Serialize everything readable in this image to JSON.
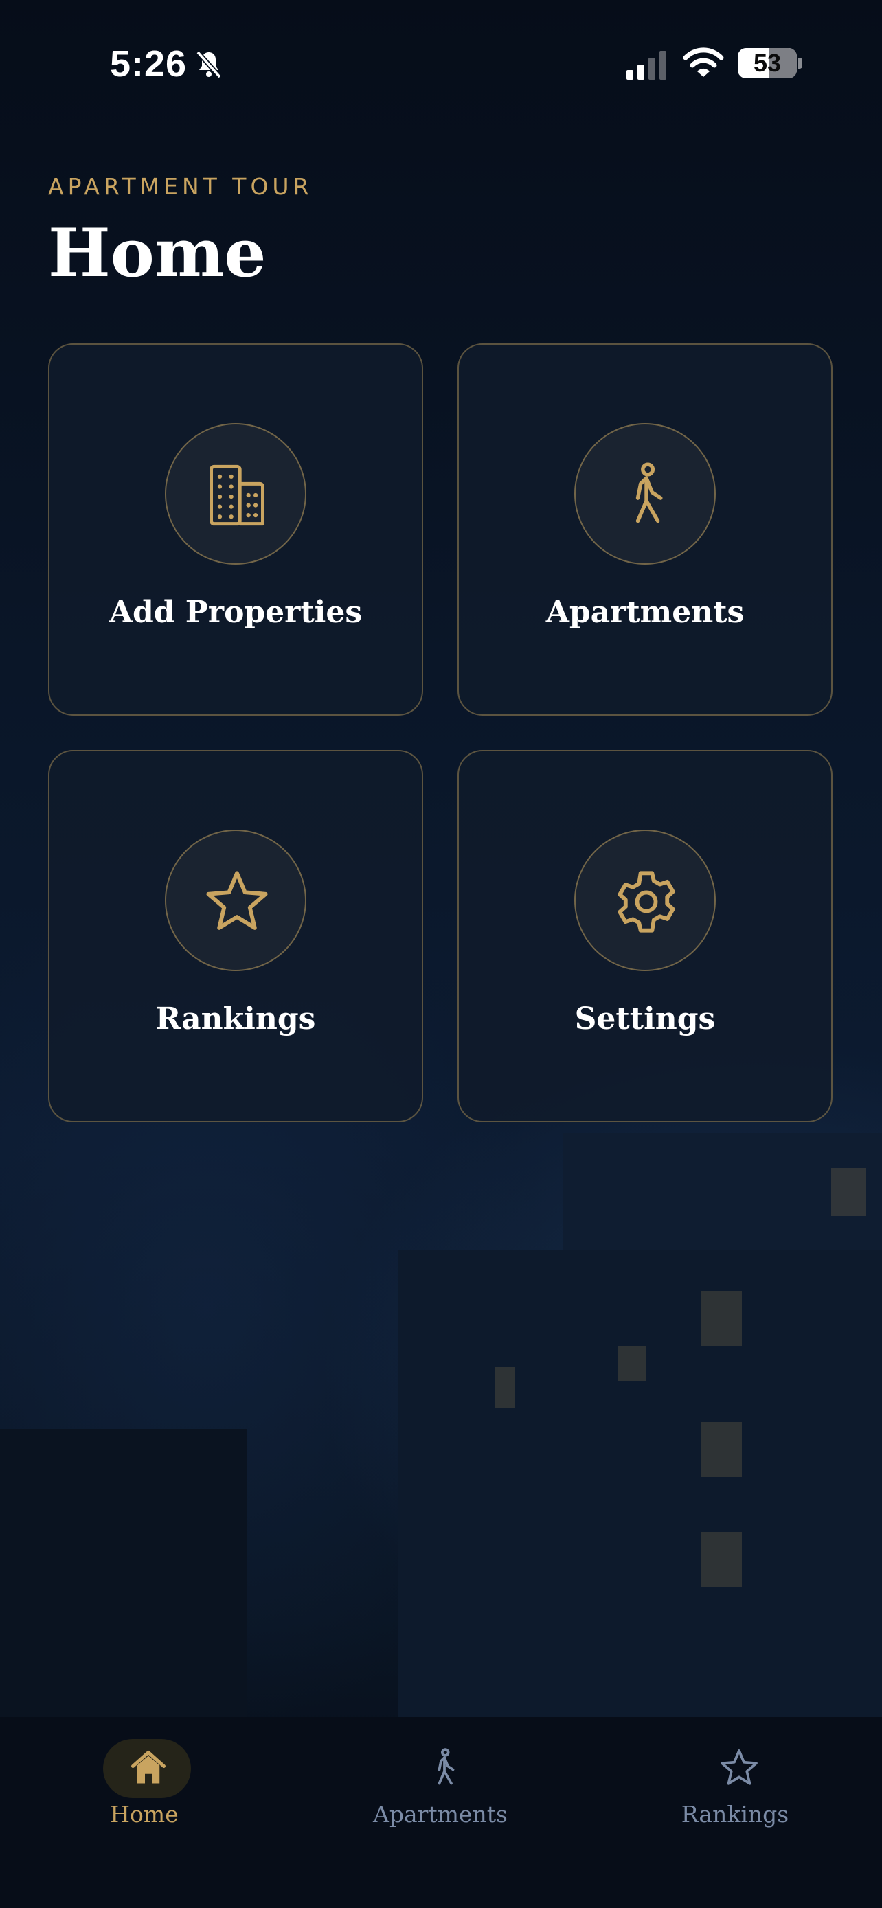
{
  "status_bar": {
    "time": "5:26",
    "battery": "53"
  },
  "header": {
    "eyebrow": "APARTMENT TOUR",
    "title": "Home"
  },
  "cards": [
    {
      "label": "Add Properties",
      "icon": "building-icon"
    },
    {
      "label": "Apartments",
      "icon": "walking-person-icon"
    },
    {
      "label": "Rankings",
      "icon": "star-icon"
    },
    {
      "label": "Settings",
      "icon": "gear-icon"
    }
  ],
  "tab_bar": {
    "items": [
      {
        "label": "Home",
        "icon": "house-icon",
        "active": true
      },
      {
        "label": "Apartments",
        "icon": "walking-person-icon",
        "active": false
      },
      {
        "label": "Rankings",
        "icon": "star-icon",
        "active": false
      }
    ]
  },
  "colors": {
    "accent": "#c9a460",
    "background": "#07101d",
    "inactive": "#7b8ba6"
  }
}
